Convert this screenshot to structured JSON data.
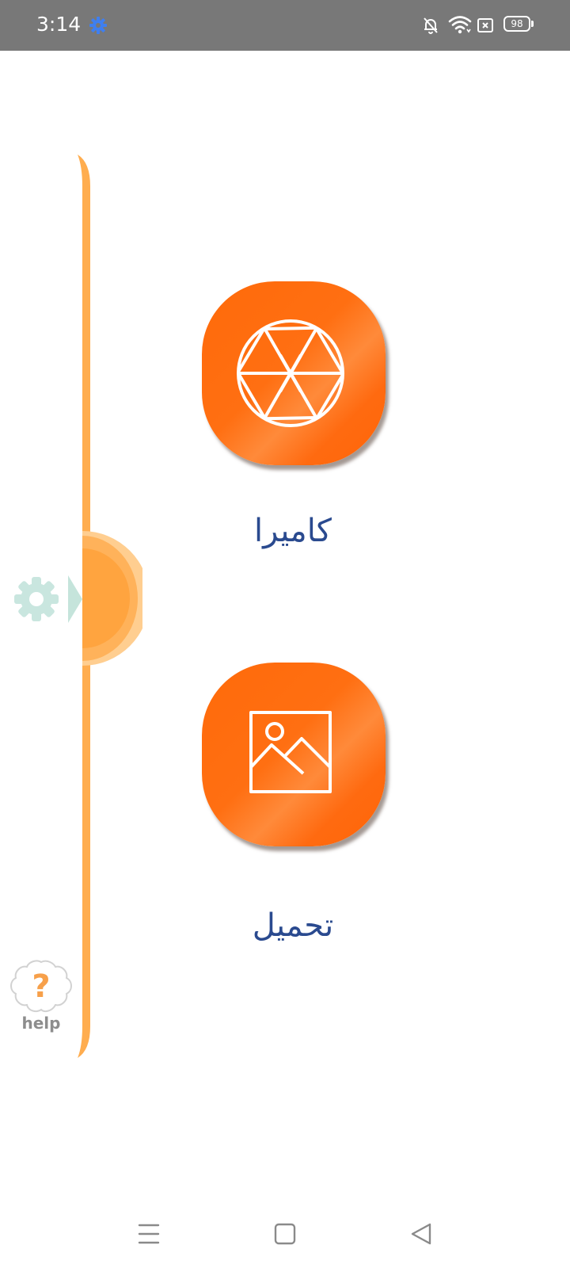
{
  "status_bar": {
    "time": "3:14",
    "battery_level": "98",
    "icons": [
      "settings-gear-icon",
      "notifications-muted-icon",
      "wifi-icon",
      "no-sim-icon",
      "battery-icon"
    ]
  },
  "side_panel": {
    "settings_icon": "gear-icon",
    "handle_icon": "chevron-right-icon",
    "help": {
      "symbol": "?",
      "label": "help"
    }
  },
  "actions": [
    {
      "id": "camera",
      "icon": "camera-aperture-icon",
      "label": "كاميرا"
    },
    {
      "id": "upload",
      "icon": "image-icon",
      "label": "تحميل"
    }
  ],
  "navigation": {
    "buttons": [
      "menu-icon",
      "home-icon",
      "back-icon"
    ]
  },
  "colors": {
    "status_bar": "#787878",
    "accent_orange": "#ff6a0a",
    "side_bar_orange": "#ffad4f",
    "label_blue": "#2a4a8f",
    "gear_teal": "#c9e6df",
    "help_orange": "#f7a04a"
  }
}
